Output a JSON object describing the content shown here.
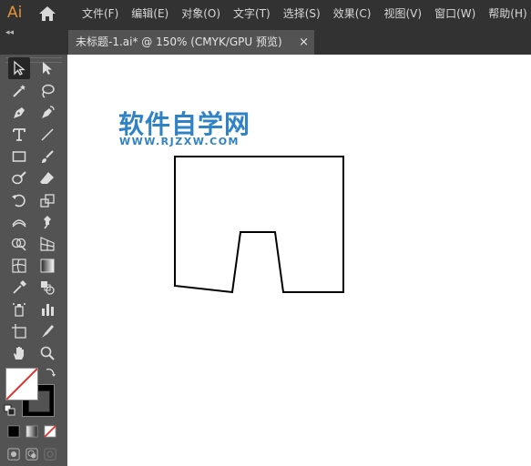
{
  "app": {
    "logo_text": "Ai",
    "brand_color": "#e1923a"
  },
  "menu": {
    "items": [
      "文件(F)",
      "编辑(E)",
      "对象(O)",
      "文字(T)",
      "选择(S)",
      "效果(C)",
      "视图(V)",
      "窗口(W)",
      "帮助(H)"
    ]
  },
  "tabs": {
    "collapse_glyph": "◂◂",
    "active": {
      "label": "未标题-1.ai* @ 150% (CMYK/GPU 预览)",
      "close": "×"
    }
  },
  "toolbar": {
    "tools": [
      "selection-tool-icon",
      "direct-selection-tool-icon",
      "magic-wand-tool-icon",
      "lasso-tool-icon",
      "pen-tool-icon",
      "curvature-tool-icon",
      "type-tool-icon",
      "line-segment-tool-icon",
      "rectangle-tool-icon",
      "paintbrush-tool-icon",
      "shaper-tool-icon",
      "eraser-tool-icon",
      "rotate-tool-icon",
      "scale-tool-icon",
      "width-tool-icon",
      "puppet-warp-tool-icon",
      "shape-builder-tool-icon",
      "perspective-grid-tool-icon",
      "mesh-tool-icon",
      "gradient-tool-icon",
      "eyedropper-tool-icon",
      "blend-tool-icon",
      "symbol-sprayer-tool-icon",
      "column-graph-tool-icon",
      "artboard-tool-icon",
      "slice-tool-icon",
      "hand-tool-icon",
      "zoom-tool-icon"
    ],
    "fill_color": "none",
    "stroke_color": "#000000"
  },
  "canvas": {
    "watermark_cn": "软件自学网",
    "watermark_url": "WWW.RJZXW.COM",
    "watermark_color": "#2f82c6"
  }
}
